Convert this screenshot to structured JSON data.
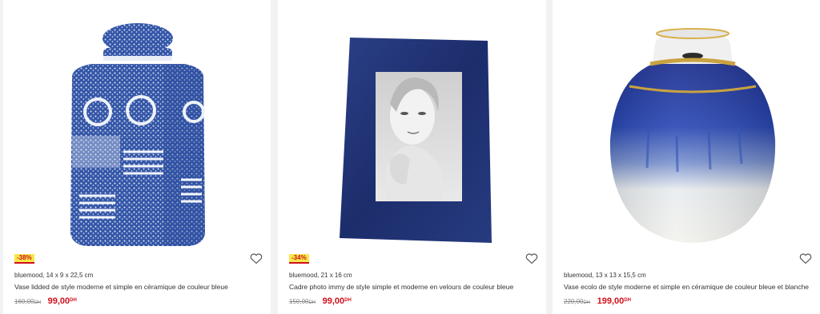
{
  "products": [
    {
      "badge": "-38%",
      "spec": "bluemood, 14 x 9 x 22,5 cm",
      "title": "Vase lidded de style moderne et simple en céramique de couleur bleue",
      "old_price": "160,00",
      "old_currency": "DH",
      "new_price": "99,00",
      "new_currency": "DH"
    },
    {
      "badge": "-34%",
      "spec": "bluemood, 21 x 16 cm",
      "title": "Cadre photo immy de style simple et moderne en velours de couleur bleue",
      "old_price": "150,00",
      "old_currency": "DH",
      "new_price": "99,00",
      "new_currency": "DH"
    },
    {
      "spec": "bluemood, 13 x 13 x 15,5 cm",
      "title": "Vase ecolo de style moderne et simple en céramique de couleur bleue et blanche",
      "old_price": "220,00",
      "old_currency": "DH",
      "new_price": "199,00",
      "new_currency": "DH"
    }
  ],
  "colors": {
    "accent": "#d0111b",
    "badge_bg": "#f6e84a",
    "navy": "#1d3a7a"
  },
  "icons": {
    "wishlist": "heart-outline-icon"
  }
}
